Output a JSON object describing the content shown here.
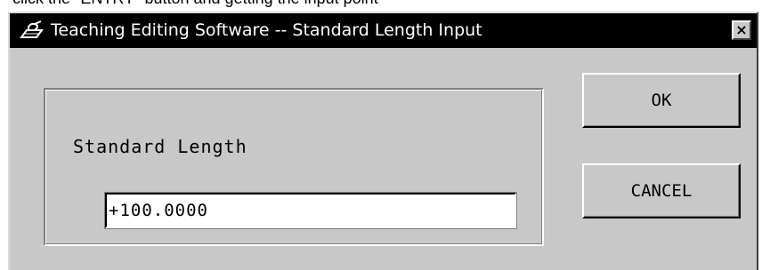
{
  "page": {
    "caption_above": "click the \"ENTRY\" button and getting the input point"
  },
  "window": {
    "title": "Teaching Editing Software -- Standard Length Input",
    "app_icon": "pen-tablet-icon",
    "close_label": "×"
  },
  "group": {
    "label": "Standard Length"
  },
  "length_field": {
    "value": "+100.0000"
  },
  "buttons": {
    "ok": "OK",
    "cancel": "CANCEL"
  },
  "colors": {
    "face": "#c8c8c8",
    "titlebar": "#000000",
    "title_text": "#ffffff",
    "field_bg": "#ffffff"
  }
}
